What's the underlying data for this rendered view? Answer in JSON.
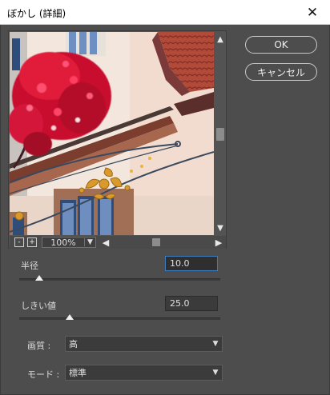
{
  "window": {
    "title": "ぼかし (詳細)"
  },
  "buttons": {
    "ok": "OK",
    "cancel": "キャンセル"
  },
  "preview": {
    "zoom": "100%",
    "zoom_out": "-",
    "zoom_in": "+"
  },
  "radius": {
    "label": "半径",
    "value": "10.0",
    "slider_fraction": 0.1
  },
  "threshold": {
    "label": "しきい値",
    "value": "25.0",
    "slider_fraction": 0.25
  },
  "quality": {
    "label": "画質 :",
    "value": "高"
  },
  "mode": {
    "label": "モード :",
    "value": "標準"
  },
  "colors": {
    "dialog_bg": "#4d4d4d",
    "focus_border": "#3d7bc0"
  }
}
